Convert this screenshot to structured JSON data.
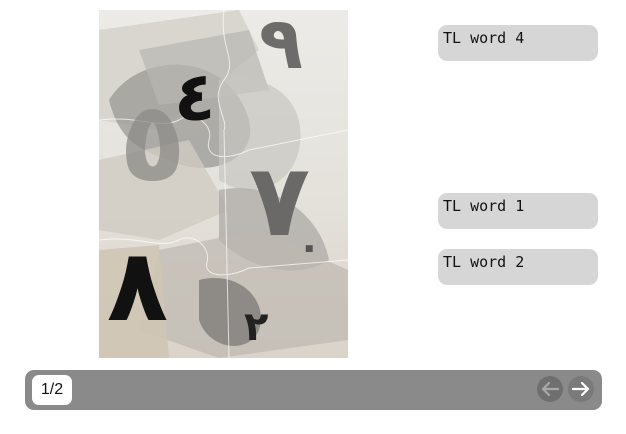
{
  "puzzle": {
    "digits": [
      "٩",
      "٤",
      "٥",
      "٧",
      "٠",
      "٨",
      "٢"
    ]
  },
  "word_cards": [
    {
      "label": "TL word 4"
    },
    {
      "label": "TL word 1"
    },
    {
      "label": "TL word 2"
    }
  ],
  "footer": {
    "page_counter": "1/2",
    "prev_icon": "arrow-left-icon",
    "next_icon": "arrow-right-icon",
    "bar_color": "#8a8a8a"
  }
}
